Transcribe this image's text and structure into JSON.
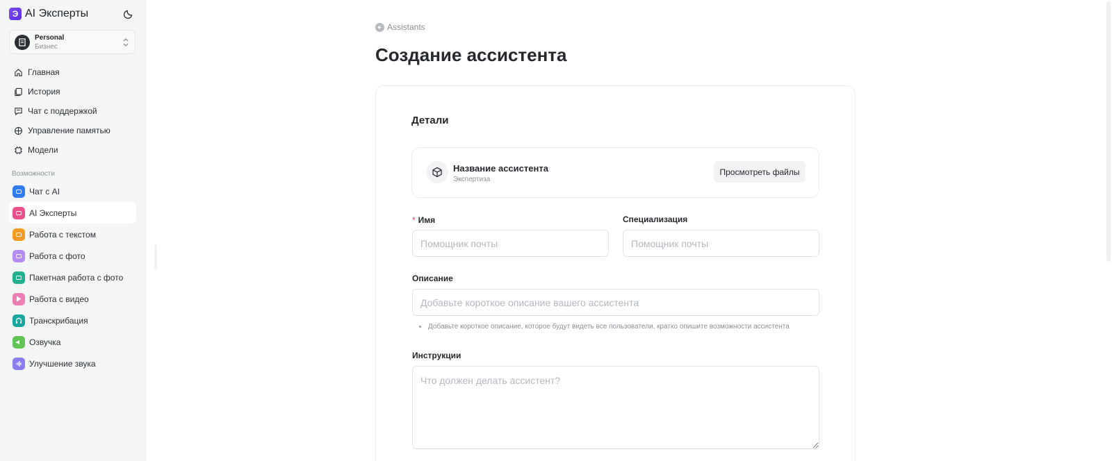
{
  "app": {
    "title": "AI Эксперты",
    "logo_letter": "Э"
  },
  "account": {
    "name": "Personal",
    "plan": "Бизнес"
  },
  "nav": [
    {
      "label": "Главная",
      "icon": "home-icon"
    },
    {
      "label": "История",
      "icon": "history-icon"
    },
    {
      "label": "Чат с поддержкой",
      "icon": "support-chat-icon"
    },
    {
      "label": "Управление памятью",
      "icon": "memory-icon"
    },
    {
      "label": "Модели",
      "icon": "models-icon"
    }
  ],
  "features": {
    "section_label": "Возможности",
    "items": [
      {
        "label": "Чат с AI",
        "color": "#2f7cf6",
        "active": false
      },
      {
        "label": "AI Эксперты",
        "color": "#ec4f8b",
        "active": true
      },
      {
        "label": "Работа с текстом",
        "color": "#f59a23",
        "active": false
      },
      {
        "label": "Работа с фото",
        "color": "#b58cf5",
        "active": false
      },
      {
        "label": "Пакетная работа с фото",
        "color": "#21b08f",
        "active": false
      },
      {
        "label": "Работа с видео",
        "color": "#ee7fb6",
        "active": false
      },
      {
        "label": "Транскрибация",
        "color": "#19a7a0",
        "active": false
      },
      {
        "label": "Озвучка",
        "color": "#62c454",
        "active": false
      },
      {
        "label": "Улучшение звука",
        "color": "#8b7cf6",
        "active": false
      }
    ]
  },
  "main": {
    "breadcrumb": "Assistants",
    "title": "Создание ассистента",
    "section_title": "Детали",
    "preview": {
      "name": "Название ассистента",
      "subtitle": "Экспертиза",
      "files_button": "Просмотреть файлы"
    },
    "fields": {
      "name": {
        "required_mark": "*",
        "label": "Имя",
        "placeholder": "Помощник почты"
      },
      "specialization": {
        "label": "Специализация",
        "placeholder": "Помощник почты"
      },
      "description": {
        "label": "Описание",
        "placeholder": "Добавьте короткое описание вашего ассистента",
        "hint": "Добавьте короткое описание, которое будут видеть все пользователи, кратко опишите возможности ассистента"
      },
      "instructions": {
        "label": "Инструкции",
        "placeholder": "Что должен делать ассистент?"
      }
    }
  }
}
